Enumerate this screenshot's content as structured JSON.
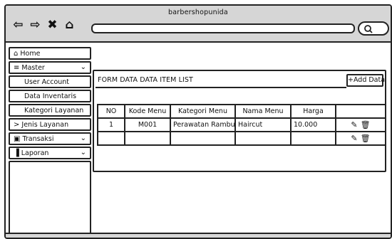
{
  "window": {
    "title": "barbershopunida"
  },
  "sidebar": {
    "items": [
      {
        "label": "Home",
        "icon": "home-icon",
        "glyph": "⌂"
      },
      {
        "label": "Master",
        "icon": "database-icon",
        "glyph": "≡",
        "chevron": "⌄"
      },
      {
        "label": "User Account"
      },
      {
        "label": "Data Inventaris"
      },
      {
        "label": "Kategori Layanan"
      },
      {
        "label": "Jenis Layanan",
        "prefix": ">"
      },
      {
        "label": "Transaksi",
        "icon": "cash-icon",
        "glyph": "▣",
        "chevron": "⌄"
      },
      {
        "label": "Laporan",
        "icon": "bar-chart-icon",
        "glyph": "▐",
        "chevron": "⌄"
      }
    ]
  },
  "panel": {
    "title": "FORM DATA DATA ITEM LIST",
    "add_label": "+Add Data"
  },
  "table": {
    "headers": [
      "NO",
      "Kode Menu",
      "Kategori Menu",
      "Nama Menu",
      "Harga",
      ""
    ],
    "rows": [
      [
        "1",
        "M001",
        "Perawatan Rambut",
        "Haircut",
        "10.000"
      ],
      [
        "",
        "",
        "",
        "",
        ""
      ]
    ]
  }
}
